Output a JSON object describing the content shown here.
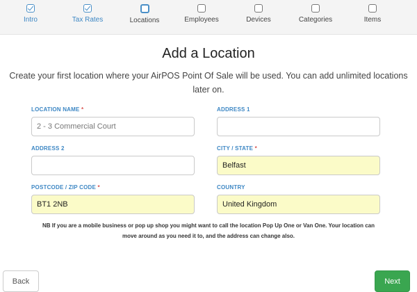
{
  "wizard": {
    "steps": [
      {
        "label": "Intro",
        "state": "done"
      },
      {
        "label": "Tax Rates",
        "state": "done"
      },
      {
        "label": "Locations",
        "state": "current"
      },
      {
        "label": "Employees",
        "state": "todo"
      },
      {
        "label": "Devices",
        "state": "todo"
      },
      {
        "label": "Categories",
        "state": "todo"
      },
      {
        "label": "Items",
        "state": "todo"
      }
    ]
  },
  "page": {
    "title": "Add a Location",
    "subtitle": "Create your first location where your AirPOS Point Of Sale will be used. You can add unlimited locations later on."
  },
  "form": {
    "location_name": {
      "label": "LOCATION NAME",
      "required": "*",
      "value": "",
      "placeholder": "2 - 3 Commercial Court"
    },
    "address1": {
      "label": "ADDRESS 1",
      "value": "",
      "placeholder": ""
    },
    "address2": {
      "label": "ADDRESS 2",
      "value": "",
      "placeholder": ""
    },
    "city_state": {
      "label": "CITY / STATE",
      "required": "*",
      "value": "Belfast"
    },
    "postcode": {
      "label": "POSTCODE / ZIP CODE",
      "required": "*",
      "value": "BT1 2NB"
    },
    "country": {
      "label": "COUNTRY",
      "value": "United Kingdom"
    }
  },
  "note": "NB If you are a mobile business or pop up shop you might want to call the location Pop Up One or Van One. Your location can move around as you need it to, and the address can change also.",
  "buttons": {
    "back": "Back",
    "next": "Next"
  },
  "colors": {
    "accent": "#3d87c4",
    "next_button": "#3aa650",
    "autofill": "#fbfbc8",
    "required": "#d9534f"
  }
}
